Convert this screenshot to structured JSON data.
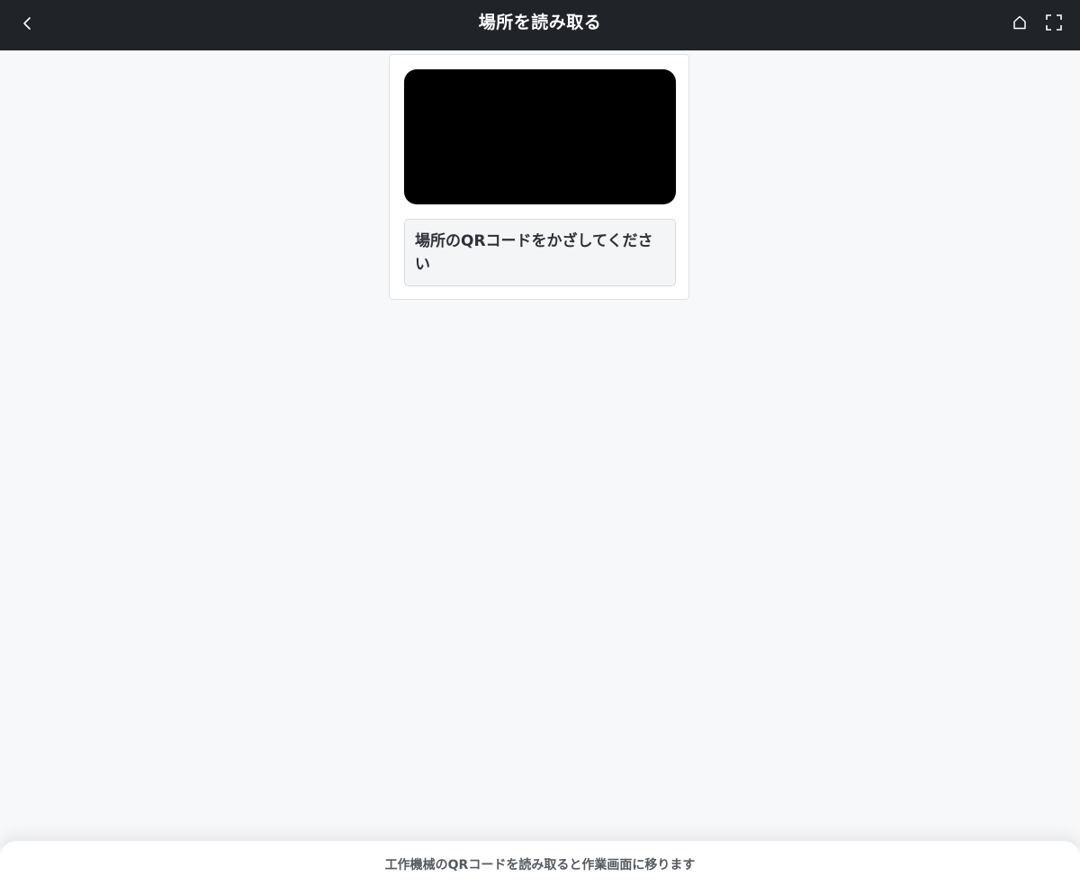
{
  "header": {
    "title": "場所を読み取る",
    "back_icon": "chevron-left-icon",
    "home_icon": "home-icon",
    "fullscreen_icon": "fullscreen-icon"
  },
  "scanner": {
    "prompt": "場所のQRコードをかざしてください"
  },
  "footer": {
    "hint": "工作機械のQRコードを読み取ると作業画面に移ります"
  },
  "colors": {
    "header_bg": "#202429",
    "page_bg": "#f7f8fa",
    "camera_bg": "#000000"
  }
}
